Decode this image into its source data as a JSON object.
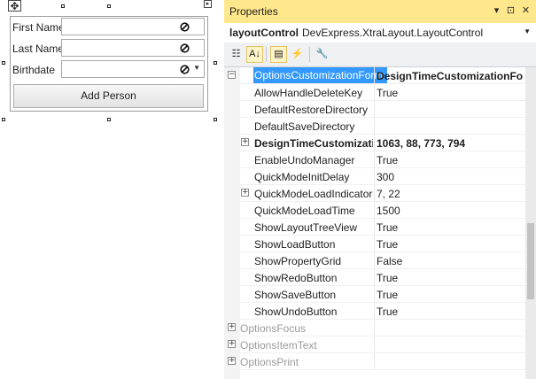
{
  "designer": {
    "move_glyph": "✥",
    "smart_tag_glyph": "▸",
    "fields": [
      {
        "label": "First Name",
        "type": "text"
      },
      {
        "label": "Last Name",
        "type": "text"
      },
      {
        "label": "Birthdate",
        "type": "combo"
      }
    ],
    "add_button_label": "Add Person",
    "combo_arrow": "▼"
  },
  "properties": {
    "title": "Properties",
    "title_buttons": {
      "dropdown": "▾",
      "pin": "⊡",
      "close": "✕"
    },
    "object_name": "layoutControl",
    "object_type": "DevExpress.XtraLayout.LayoutControl",
    "object_dropdown": "▼",
    "toolbar": [
      {
        "name": "categorized-icon",
        "glyph": "☷",
        "active": false
      },
      {
        "name": "alphabetical-icon",
        "glyph": "A↓",
        "active": true
      },
      {
        "name": "property-pages-icon",
        "glyph": "▤",
        "active": true
      },
      {
        "name": "events-icon",
        "glyph": "⚡",
        "active": false
      },
      {
        "name": "wrench-icon",
        "glyph": "🔧",
        "active": false
      }
    ],
    "rows": [
      {
        "kind": "cat",
        "expander": "⊟",
        "name": "OptionsCustomizationForm",
        "value": "DesignTimeCustomizationFo",
        "selected": true
      },
      {
        "kind": "prop",
        "expander": "",
        "name": "AllowHandleDeleteKey",
        "value": "True"
      },
      {
        "kind": "prop",
        "expander": "",
        "name": "DefaultRestoreDirectory",
        "value": ""
      },
      {
        "kind": "prop",
        "expander": "",
        "name": "DefaultSaveDirectory",
        "value": ""
      },
      {
        "kind": "prop",
        "expander": "⊞",
        "name": "DesignTimeCustomizatio",
        "value": "1063, 88, 773, 794",
        "bold": true
      },
      {
        "kind": "prop",
        "expander": "",
        "name": "EnableUndoManager",
        "value": "True"
      },
      {
        "kind": "prop",
        "expander": "",
        "name": "QuickModeInitDelay",
        "value": "300"
      },
      {
        "kind": "prop",
        "expander": "⊞",
        "name": "QuickModeLoadIndicator",
        "value": "7, 22"
      },
      {
        "kind": "prop",
        "expander": "",
        "name": "QuickModeLoadTime",
        "value": "1500"
      },
      {
        "kind": "prop",
        "expander": "",
        "name": "ShowLayoutTreeView",
        "value": "True"
      },
      {
        "kind": "prop",
        "expander": "",
        "name": "ShowLoadButton",
        "value": "True"
      },
      {
        "kind": "prop",
        "expander": "",
        "name": "ShowPropertyGrid",
        "value": "False"
      },
      {
        "kind": "prop",
        "expander": "",
        "name": "ShowRedoButton",
        "value": "True"
      },
      {
        "kind": "prop",
        "expander": "",
        "name": "ShowSaveButton",
        "value": "True"
      },
      {
        "kind": "prop",
        "expander": "",
        "name": "ShowUndoButton",
        "value": "True"
      },
      {
        "kind": "cat",
        "expander": "⊞",
        "name": "OptionsFocus",
        "value": "",
        "disabled": true
      },
      {
        "kind": "cat",
        "expander": "⊞",
        "name": "OptionsItemText",
        "value": "",
        "disabled": true
      },
      {
        "kind": "cat",
        "expander": "⊞",
        "name": "OptionsPrint",
        "value": "",
        "disabled": true
      }
    ]
  },
  "colors": {
    "title_bar": "#ffe88c",
    "selection": "#3399ff"
  }
}
